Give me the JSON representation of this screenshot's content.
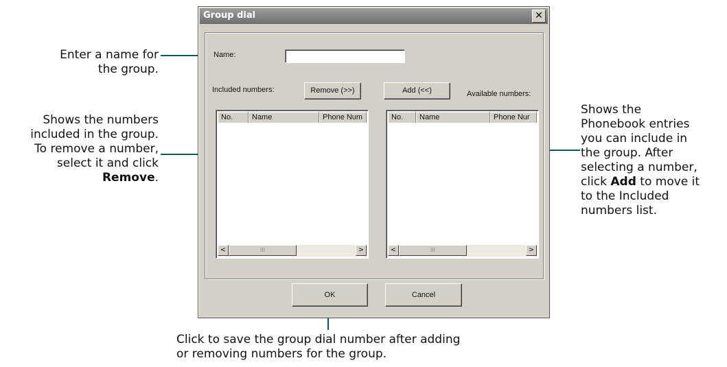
{
  "dialog": {
    "title": "Group dial",
    "close_glyph": "✕",
    "name_label": "Name:",
    "name_value": "",
    "included_label": "Included numbers:",
    "available_label": "Available numbers:",
    "remove_button": "Remove (>>)",
    "add_button": "Add (<<)",
    "ok_button": "OK",
    "cancel_button": "Cancel",
    "included_columns": [
      "No.",
      "Name",
      "Phone Num"
    ],
    "available_columns": [
      "No.",
      "Name",
      "Phone Nur"
    ],
    "scroll_left_glyph": "<",
    "scroll_right_glyph": ">",
    "scroll_thumb_glyph": "III"
  },
  "annotations": {
    "name": [
      "Enter a name for",
      "the group."
    ],
    "included": [
      "Shows the numbers",
      "included in the group.",
      "To remove a number,",
      "select it and click"
    ],
    "included_bold": "Remove",
    "included_tail": ".",
    "available_1": [
      "Shows the",
      "Phonebook entries",
      "you can include in",
      "the group. After",
      "selecting a number,"
    ],
    "available_click": "click ",
    "available_bold": "Add",
    "available_tail": " to move it",
    "available_2": [
      "to the Included",
      "numbers list."
    ],
    "ok": [
      "Click to save the group dial number after adding",
      "or removing numbers for the group."
    ]
  },
  "colors": {
    "leader_line": "#0b5a57",
    "dialog_face": "#d4d0c8",
    "titlebar": "#7d7d7d"
  }
}
